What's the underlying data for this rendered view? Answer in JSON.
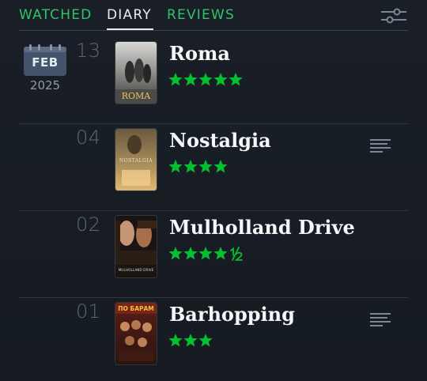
{
  "tabs": [
    {
      "label": "WATCHED",
      "active": false
    },
    {
      "label": "DIARY",
      "active": true
    },
    {
      "label": "REVIEWS",
      "active": false
    }
  ],
  "filter_icon": "sliders-icon",
  "colors": {
    "accent_green": "#2fc46a",
    "star_green": "#00c030",
    "background": "#171c23",
    "text_primary": "#f4f6f8",
    "text_muted": "#5e6875"
  },
  "month_group": {
    "month": "FEB",
    "year": "2025"
  },
  "entries": [
    {
      "day": "13",
      "title": "Roma",
      "rating": 5,
      "has_review": false,
      "poster_text": "ROMA"
    },
    {
      "day": "04",
      "title": "Nostalgia",
      "rating": 4,
      "has_review": true,
      "poster_text": "NOSTALGIA"
    },
    {
      "day": "02",
      "title": "Mulholland Drive",
      "rating": 4.5,
      "has_review": false,
      "poster_text": "MULHOLLAND DRIVE"
    },
    {
      "day": "01",
      "title": "Barhopping",
      "rating": 3,
      "has_review": true,
      "poster_text": "ПО БАРАМ"
    }
  ]
}
